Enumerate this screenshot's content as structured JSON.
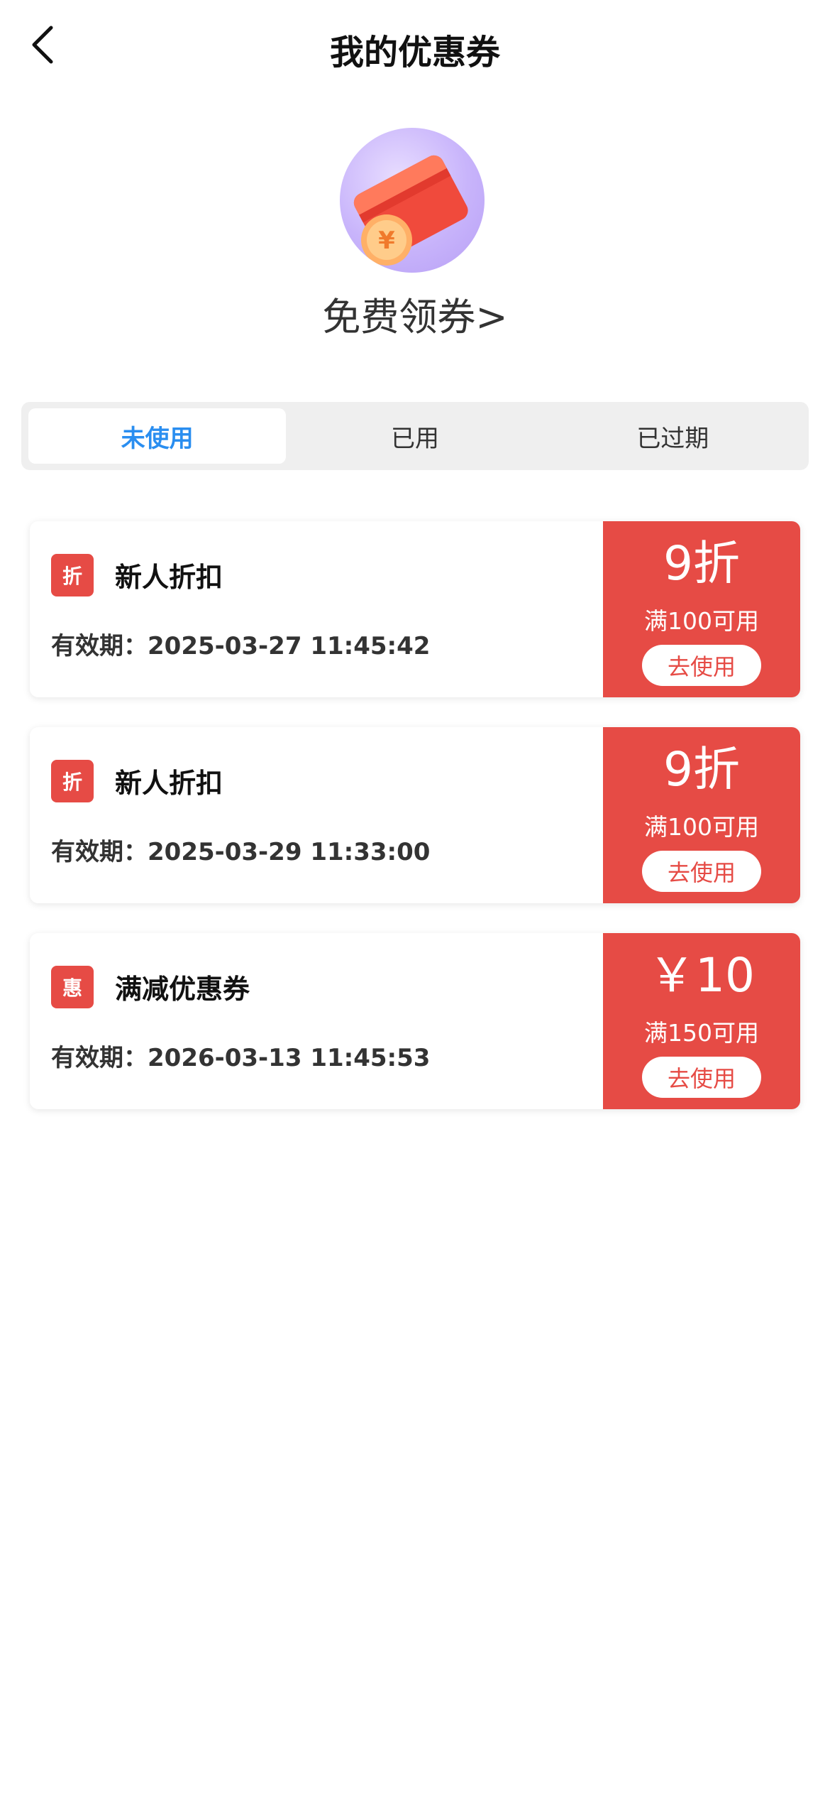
{
  "header": {
    "title": "我的优惠券",
    "back_icon": "chevron-left-icon"
  },
  "free_entry": {
    "label": "免费领券>",
    "icon": "red-envelope-coin-icon"
  },
  "tabs": [
    {
      "label": "未使用",
      "active": true
    },
    {
      "label": "已用",
      "active": false
    },
    {
      "label": "已过期",
      "active": false
    }
  ],
  "coupons": [
    {
      "badge": "折",
      "name": "新人折扣",
      "validity": "有效期：2025-03-27 11:45:42",
      "value": "9折",
      "condition": "满100可用",
      "action": "去使用"
    },
    {
      "badge": "折",
      "name": "新人折扣",
      "validity": "有效期：2025-03-29 11:33:00",
      "value": "9折",
      "condition": "满100可用",
      "action": "去使用"
    },
    {
      "badge": "惠",
      "name": "满减优惠券",
      "validity": "有效期：2026-03-13 11:45:53",
      "value": "￥10",
      "condition": "满150可用",
      "action": "去使用"
    }
  ],
  "colors": {
    "accent_red": "#e64b45",
    "active_tab_blue": "#2a8ef0",
    "tab_bg": "#efefef"
  }
}
